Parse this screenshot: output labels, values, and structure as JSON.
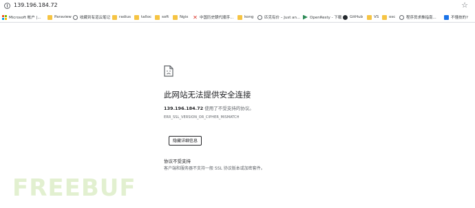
{
  "address_bar": {
    "url": "139.196.184.72"
  },
  "bookmarks": [
    {
      "label": "Microsoft 帐户 |...",
      "icon": "microsoft-icon"
    },
    {
      "label": "Paraview",
      "icon": "folder-icon"
    },
    {
      "label": "收藏到有道云笔记",
      "icon": "globe-icon"
    },
    {
      "label": "radius",
      "icon": "folder-icon"
    },
    {
      "label": "talloc",
      "icon": "folder-icon"
    },
    {
      "label": "soft",
      "icon": "folder-icon"
    },
    {
      "label": "Ngix",
      "icon": "folder-icon"
    },
    {
      "label": "中国历史朝代顺序...",
      "icon": "x-icon"
    },
    {
      "label": "kong",
      "icon": "folder-icon"
    },
    {
      "label": "匹克有价 – Just an...",
      "icon": "globe-icon"
    },
    {
      "label": "OpenResty - 下载",
      "icon": "openresty-icon"
    },
    {
      "label": "GitHub",
      "icon": "github-icon"
    },
    {
      "label": "VS",
      "icon": "folder-icon"
    },
    {
      "label": "osc",
      "icon": "folder-icon"
    },
    {
      "label": "程序员求推指南...",
      "icon": "globe-icon"
    },
    {
      "label": "不懂技的?",
      "icon": "blue-box-icon"
    }
  ],
  "error_page": {
    "title": "此网站无法提供安全连接",
    "host": "139.196.184.72",
    "detail_suffix": " 使用了不受支持的协议。",
    "code": "ERR_SSL_VERSION_OR_CIPHER_MISMATCH",
    "details_button": "隐藏详细信息",
    "sub_heading": "协议不受支持",
    "sub_text": "客户端和服务器不支持一般 SSL 协议版本或加密套件。"
  },
  "watermark": "FREEBUF"
}
